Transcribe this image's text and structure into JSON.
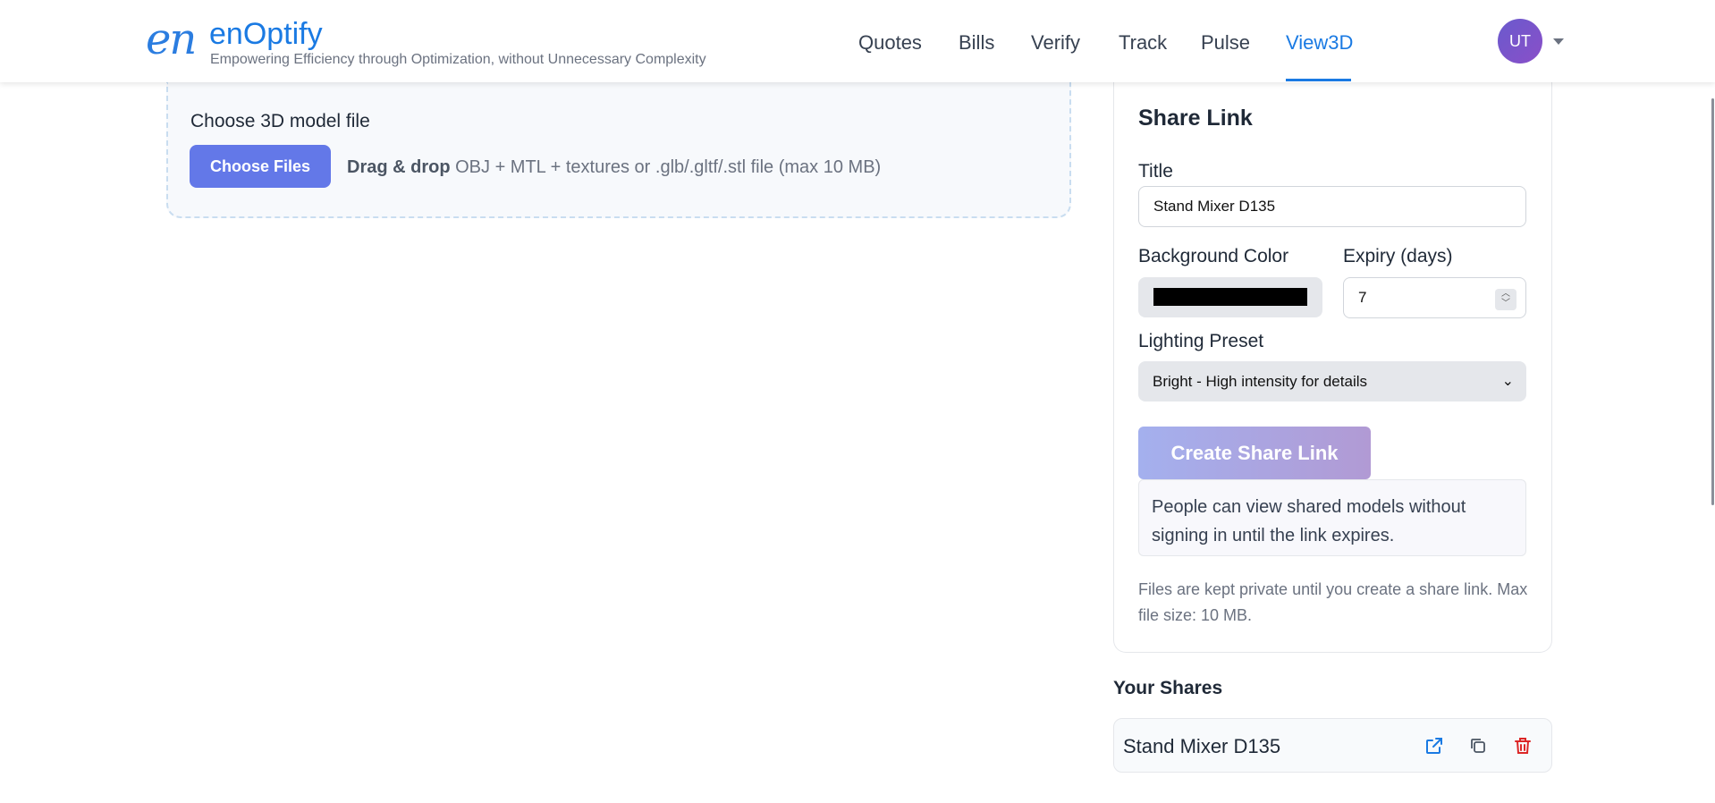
{
  "header": {
    "logo_mark": "en",
    "brand": "enOptify",
    "tagline": "Empowering Efficiency through Optimization, without Unnecessary Complexity",
    "nav": [
      {
        "label": "Quotes"
      },
      {
        "label": "Bills"
      },
      {
        "label": "Verify"
      },
      {
        "label": "Track"
      },
      {
        "label": "Pulse"
      },
      {
        "label": "View3D",
        "active": true
      }
    ],
    "user_initials": "UT"
  },
  "upload": {
    "title": "Choose 3D model file",
    "button": "Choose Files",
    "drop_bold": "Drag & drop",
    "drop_text": " OBJ + MTL + textures or .glb/.gltf/.stl file (max 10 MB)"
  },
  "share": {
    "title": "Share Link",
    "title_label": "Title",
    "title_value": "Stand Mixer D135",
    "bg_label": "Background Color",
    "bg_value": "#000000",
    "expiry_label": "Expiry (days)",
    "expiry_value": "7",
    "lighting_label": "Lighting Preset",
    "lighting_value": "Bright - High intensity for details",
    "create_button": "Create Share Link",
    "info": "People can view shared models without signing in until the link expires.",
    "note": "Files are kept private until you create a share link. Max file size: 10 MB."
  },
  "shares": {
    "title": "Your Shares",
    "items": [
      {
        "title": "Stand Mixer D135",
        "icons": [
          "open-external-icon",
          "copy-icon",
          "trash-icon"
        ]
      }
    ]
  },
  "colors": {
    "accent": "#1a7ae3",
    "button": "#6378e8",
    "danger": "#dc2626"
  }
}
